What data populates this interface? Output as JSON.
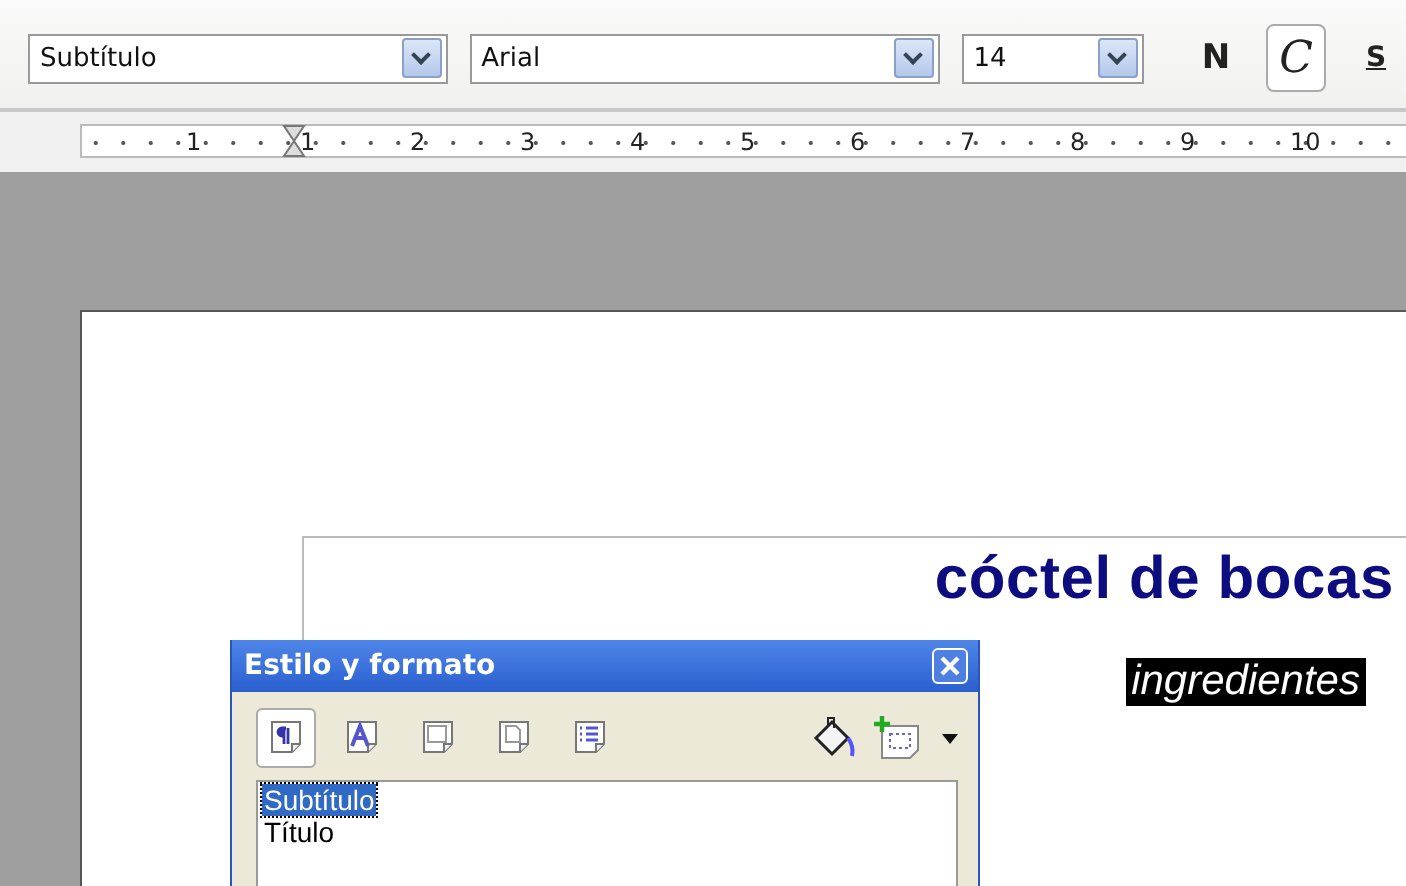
{
  "toolbar": {
    "paragraph_style": "Subtítulo",
    "font_name": "Arial",
    "font_size": "14",
    "format_buttons": [
      {
        "label": "N",
        "kind": "bold",
        "selected": false
      },
      {
        "label": "C",
        "kind": "italic",
        "selected": true
      },
      {
        "label": "S",
        "kind": "underline",
        "selected": false
      }
    ]
  },
  "ruler": {
    "labels": [
      "1",
      "1",
      "2",
      "3",
      "4",
      "5",
      "6",
      "7",
      "8",
      "9",
      "10"
    ]
  },
  "document": {
    "title": "cóctel de bocas",
    "highlighted_text": "ingredientes"
  },
  "styles_window": {
    "title": "Estilo y formato",
    "categories": [
      {
        "kind": "paragraph",
        "selected": true
      },
      {
        "kind": "character",
        "selected": false
      },
      {
        "kind": "frame",
        "selected": false
      },
      {
        "kind": "page",
        "selected": false
      },
      {
        "kind": "list",
        "selected": false
      }
    ],
    "styles": [
      {
        "label": "Subtítulo",
        "selected": true
      },
      {
        "label": "Título",
        "selected": false
      }
    ]
  }
}
